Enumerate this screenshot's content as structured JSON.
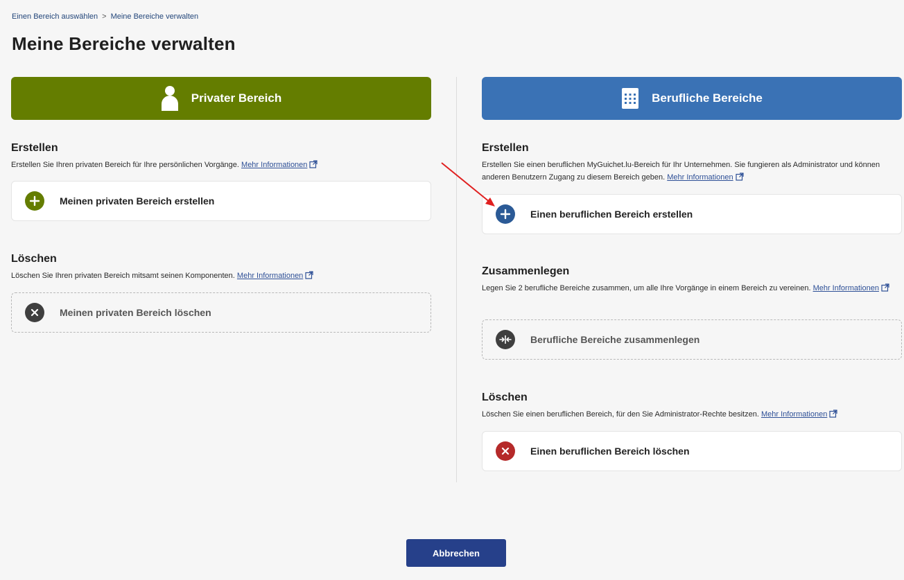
{
  "breadcrumb": {
    "items": [
      "Einen Bereich auswählen",
      "Meine Bereiche verwalten"
    ],
    "separator": ">"
  },
  "page_title": "Meine Bereiche verwalten",
  "private": {
    "header": "Privater Bereich",
    "header_icon": "person-icon",
    "color": "#647d00",
    "create": {
      "title": "Erstellen",
      "text": "Erstellen Sie Ihren privaten Bereich für Ihre persönlichen Vorgänge.",
      "link": "Mehr Informationen",
      "action": "Meinen privaten Bereich erstellen",
      "icon": "plus-circle-icon",
      "icon_color": "#647d00"
    },
    "delete": {
      "title": "Löschen",
      "text": "Löschen Sie Ihren privaten Bereich mitsamt seinen Komponenten.",
      "link": "Mehr Informationen",
      "action": "Meinen privaten Bereich löschen",
      "icon": "close-circle-icon",
      "icon_color": "#3f3f3f"
    }
  },
  "professional": {
    "header": "Berufliche Bereiche",
    "header_icon": "building-icon",
    "color": "#3a72b5",
    "create": {
      "title": "Erstellen",
      "text": "Erstellen Sie einen beruflichen MyGuichet.lu-Bereich für Ihr Unternehmen. Sie fungieren als Administrator und können anderen Benutzern Zugang zu diesem Bereich geben.",
      "link": "Mehr Informationen",
      "action": "Einen beruflichen Bereich erstellen",
      "icon": "plus-circle-icon",
      "icon_color": "#2b5a96"
    },
    "merge": {
      "title": "Zusammenlegen",
      "text": "Legen Sie 2 berufliche Bereiche zusammen, um alle Ihre Vorgänge in einem Bereich zu vereinen.",
      "link": "Mehr Informationen",
      "action": "Berufliche Bereiche zusammenlegen",
      "icon": "merge-icon",
      "icon_color": "#3f3f3f"
    },
    "delete": {
      "title": "Löschen",
      "text": "Löschen Sie einen beruflichen Bereich, für den Sie Administrator-Rechte besitzen.",
      "link": "Mehr Informationen",
      "action": "Einen beruflichen Bereich löschen",
      "icon": "close-circle-icon",
      "icon_color": "#b52a2a"
    }
  },
  "cancel_button": "Abbrechen",
  "annotation_arrow_color": "#e02020"
}
